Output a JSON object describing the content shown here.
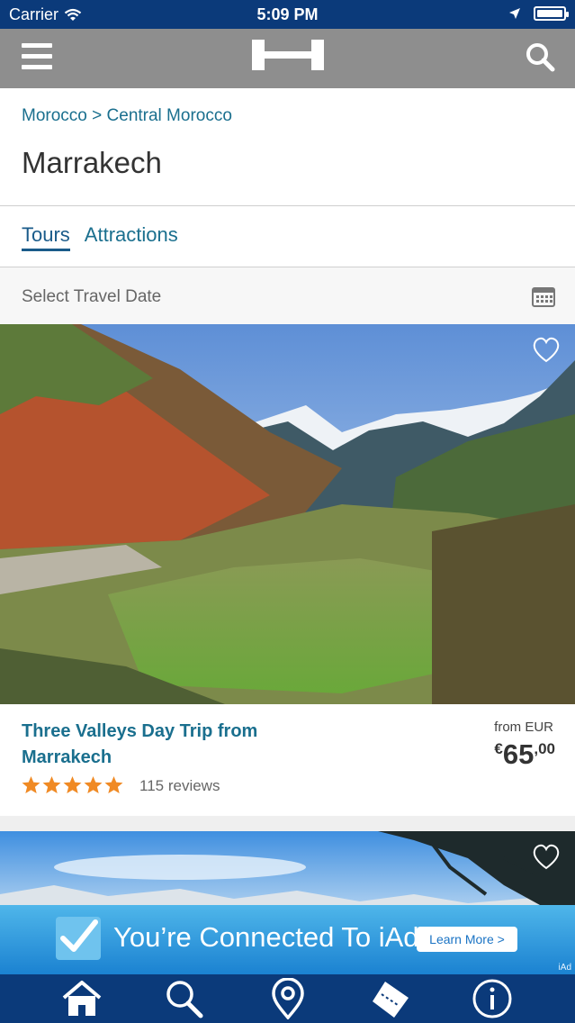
{
  "status_bar": {
    "carrier": "Carrier",
    "time": "5:09 PM"
  },
  "nav": {
    "logo_icon": "hotels-h-logo-icon",
    "menu_icon": "hamburger-menu-icon",
    "search_icon": "search-icon"
  },
  "breadcrumb": {
    "country": "Morocco",
    "separator": ">",
    "region": "Central Morocco"
  },
  "page_title": "Marrakech",
  "tabs": [
    {
      "label": "Tours",
      "active": true
    },
    {
      "label": "Attractions",
      "active": false
    }
  ],
  "travel_date": {
    "label": "Select Travel Date",
    "icon": "calendar-icon"
  },
  "cards": [
    {
      "title": "Three Valleys Day Trip from Marrakech",
      "rating": 5,
      "reviews": "115 reviews",
      "price_from": "from EUR",
      "price_currency": "€",
      "price_whole": "65",
      "price_cents": ",00",
      "favorite_icon": "heart-outline-icon"
    }
  ],
  "ad": {
    "text": "You’re Connected To iAd",
    "button": "Learn More",
    "button_chevron": ">",
    "tag": "iAd"
  },
  "tabbar": [
    "home-icon",
    "search-icon",
    "location-pin-icon",
    "ticket-icon",
    "info-icon"
  ],
  "colors": {
    "status_bar": "#0b3a7a",
    "nav_bar": "#8e8e8e",
    "link": "#1a6f8e",
    "star": "#f08a24",
    "ad": "#1b82d1"
  }
}
